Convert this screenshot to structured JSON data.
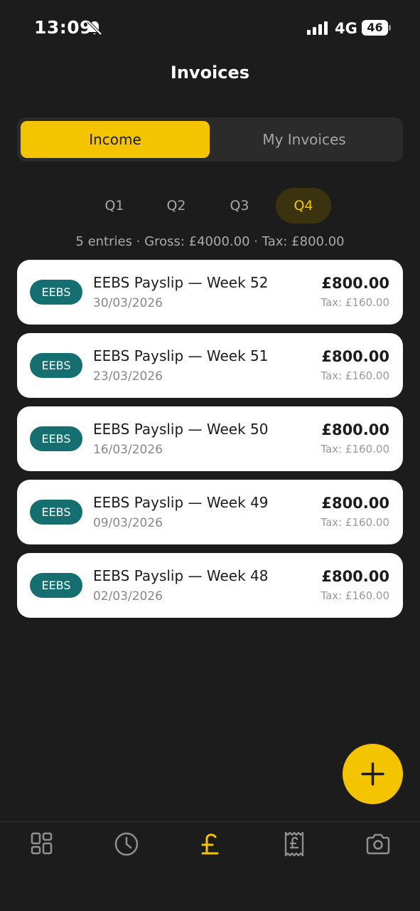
{
  "status_bar": {
    "time": "13:09",
    "network": "4G",
    "battery": "46",
    "icons": [
      "bell-muted-icon",
      "signal-icon",
      "battery-icon"
    ]
  },
  "header": {
    "title": "Invoices"
  },
  "segment": {
    "options": [
      "Income",
      "My Invoices"
    ],
    "selected": "Income"
  },
  "quarters": {
    "tabs": [
      "Q1",
      "Q2",
      "Q3",
      "Q4"
    ],
    "selected": "Q4"
  },
  "summary": "5 entries · Gross: £4000.00 · Tax: £800.00",
  "entries": [
    {
      "badge": "EEBS",
      "title": "EEBS Payslip — Week 52",
      "date": "30/03/2026",
      "amount": "£800.00",
      "tax": "Tax: £160.00"
    },
    {
      "badge": "EEBS",
      "title": "EEBS Payslip — Week 51",
      "date": "23/03/2026",
      "amount": "£800.00",
      "tax": "Tax: £160.00"
    },
    {
      "badge": "EEBS",
      "title": "EEBS Payslip — Week 50",
      "date": "16/03/2026",
      "amount": "£800.00",
      "tax": "Tax: £160.00"
    },
    {
      "badge": "EEBS",
      "title": "EEBS Payslip — Week 49",
      "date": "09/03/2026",
      "amount": "£800.00",
      "tax": "Tax: £160.00"
    },
    {
      "badge": "EEBS",
      "title": "EEBS Payslip — Week 48",
      "date": "02/03/2026",
      "amount": "£800.00",
      "tax": "Tax: £160.00"
    }
  ],
  "fab": {
    "icon": "plus-icon"
  },
  "bottom_nav": {
    "items": [
      {
        "icon": "dashboard-grid-icon",
        "active": false
      },
      {
        "icon": "clock-icon",
        "active": false
      },
      {
        "icon": "pound-icon",
        "active": true
      },
      {
        "icon": "receipt-pound-icon",
        "active": false
      },
      {
        "icon": "camera-icon",
        "active": false
      }
    ]
  },
  "colors": {
    "background": "#1c1c1c",
    "accent": "#f5c400",
    "badge": "#156f71",
    "card": "#ffffff",
    "nav_inactive": "#8f8f8f"
  }
}
